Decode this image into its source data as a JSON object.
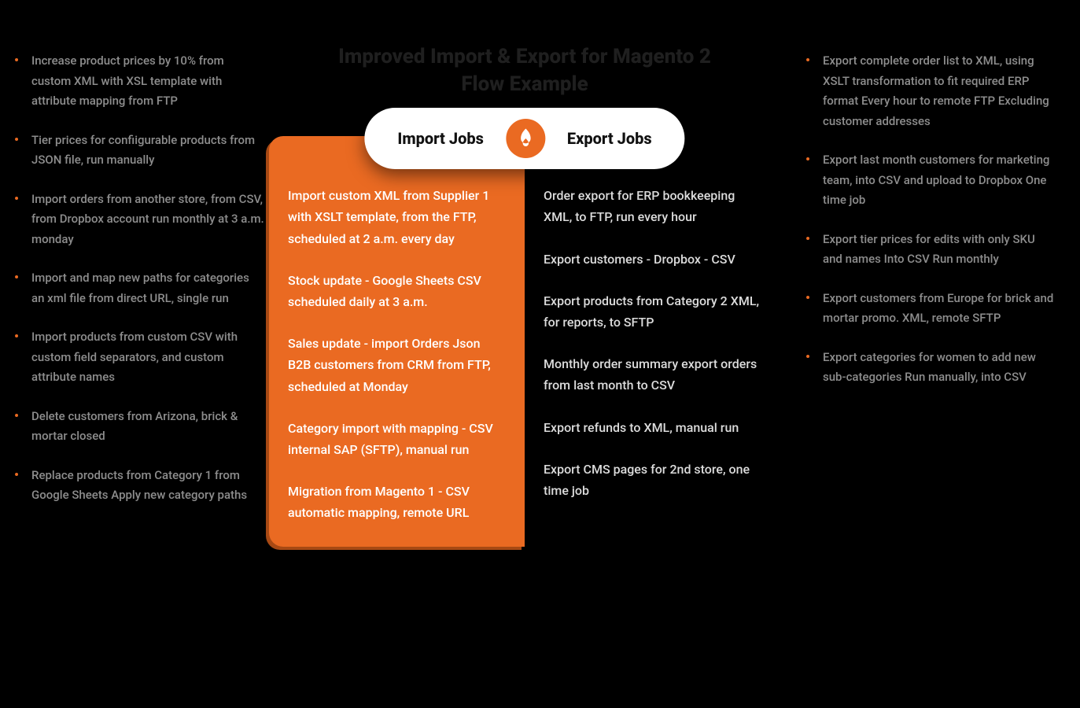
{
  "title": {
    "line1": "Improved Import & Export for Magento 2",
    "line2": "Flow Example"
  },
  "pill": {
    "import_label": "Import Jobs",
    "export_label": "Export Jobs",
    "icon": "firebear-icon"
  },
  "left_items": [
    "Increase product prices by 10% from custom XML with XSL template with attribute mapping from FTP",
    "Tier prices for confiigurable products from JSON file, run manually",
    "Import orders from another store, from CSV, from Dropbox account run monthly at 3 a.m. monday",
    "Import and map new paths for categories an xml file from direct URL, single run",
    "Import products from custom CSV with custom field separators, and custom attribute names",
    "Delete customers from Arizona, brick & mortar closed",
    "Replace products from Category 1 from Google Sheets Apply new category paths"
  ],
  "right_items": [
    "Export complete order list to XML, using XSLT transformation to fit required ERP format Every hour to remote FTP Excluding customer addresses",
    "Export last month customers for marketing team, into CSV and upload to Dropbox One time job",
    "Export tier prices for edits with only SKU and names Into CSV Run monthly",
    "Export customers from Europe for brick and mortar promo. XML, remote SFTP",
    "Export categories for women to add new sub-categories Run manually, into CSV"
  ],
  "import_jobs": [
    "Import custom XML from Supplier 1 with XSLT template, from the FTP, scheduled at 2 a.m. every day",
    "Stock update - Google Sheets CSV scheduled daily at 3 a.m.",
    "Sales update - import Orders Json B2B customers from CRM from FTP, scheduled at Monday",
    "Category import with mapping - CSV internal SAP (SFTP), manual run",
    "Migration from Magento 1 - CSV automatic mapping, remote URL"
  ],
  "export_jobs": [
    "Order export for ERP bookkeeping XML, to FTP, run every hour",
    "Export customers - Dropbox - CSV",
    "Export products from Category 2 XML, for reports, to SFTP",
    "Monthly order summary export orders from last month to CSV",
    "Export refunds to XML, manual run",
    "Export CMS pages for 2nd store, one time job"
  ]
}
